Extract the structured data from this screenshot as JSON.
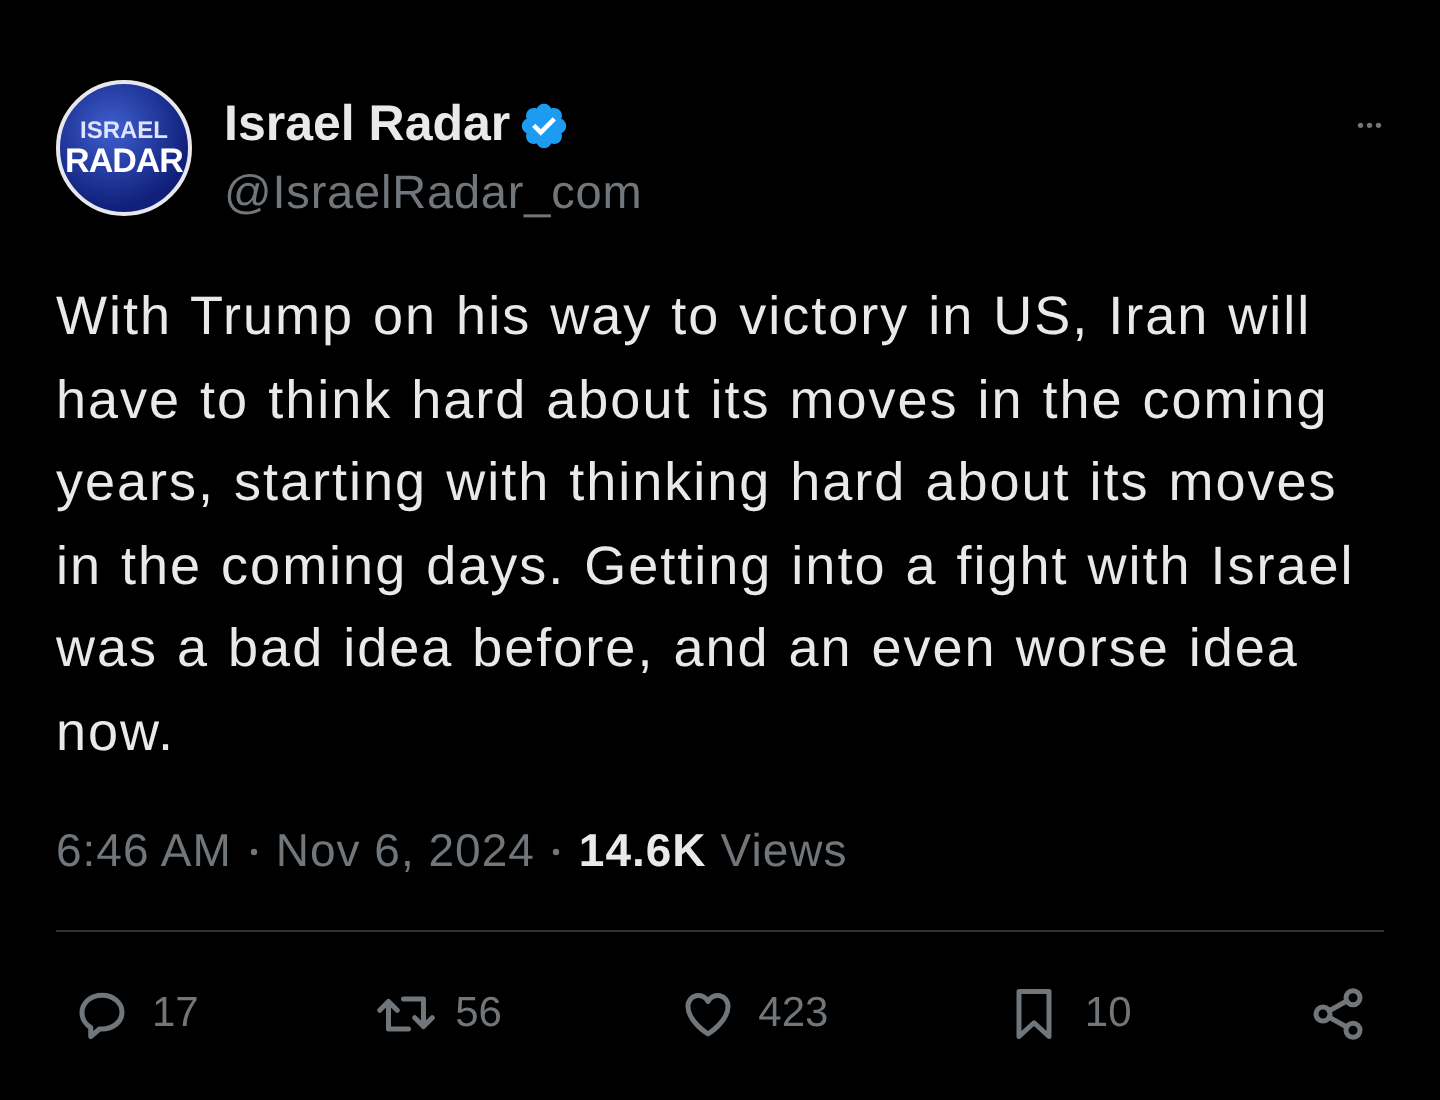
{
  "author": {
    "avatar_lines": [
      "ISRAEL",
      "RADAR"
    ],
    "name": "Israel Radar",
    "verified": true,
    "handle": "@IsraelRadar_com"
  },
  "more": "•••",
  "text": "With Trump on his way to victory in US, Iran will have to think hard about its moves in the coming years, starting with thinking hard about its moves in the coming days. Getting into a fight with Israel was a bad idea before, and an even worse idea now.",
  "meta": {
    "time": "6:46 AM",
    "date": "Nov 6, 2024",
    "views_count": "14.6K",
    "views_label": "Views"
  },
  "actions": [
    {
      "kind": "reply",
      "count": "17"
    },
    {
      "kind": "repost",
      "count": "56"
    },
    {
      "kind": "like",
      "count": "423"
    },
    {
      "kind": "bookmark",
      "count": "10"
    },
    {
      "kind": "share"
    }
  ]
}
